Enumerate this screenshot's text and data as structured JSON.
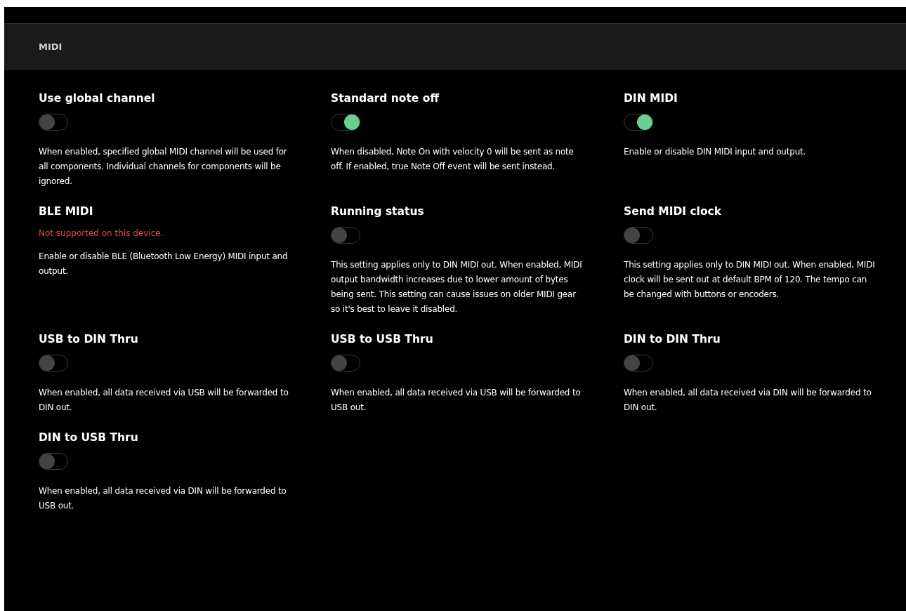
{
  "section": {
    "title": "MIDI"
  },
  "settings": [
    {
      "kind": "toggle",
      "title": "Use global channel",
      "on": false,
      "description": "When enabled, specified global MIDI channel will be used for all components. Individual channels for components will be ignored."
    },
    {
      "kind": "toggle",
      "title": "Standard note off",
      "on": true,
      "description": "When disabled, Note On with velocity 0 will be sent as note off. If enabled, true Note Off event will be sent instead."
    },
    {
      "kind": "toggle",
      "title": "DIN MIDI",
      "on": true,
      "description": "Enable or disable DIN MIDI input and output."
    },
    {
      "kind": "unsupported",
      "title": "BLE MIDI",
      "warning": "Not supported on this device.",
      "description": "Enable or disable BLE (Bluetooth Low Energy) MIDI input and output."
    },
    {
      "kind": "toggle",
      "title": "Running status",
      "on": false,
      "description": "This setting applies only to DIN MIDI out. When enabled, MIDI output bandwidth increases due to lower amount of bytes being sent. This setting can cause issues on older MIDI gear so it's best to leave it disabled."
    },
    {
      "kind": "toggle",
      "title": "Send MIDI clock",
      "on": false,
      "description": "This setting applies only to DIN MIDI out. When enabled, MIDI clock will be sent out at default BPM of 120. The tempo can be changed with buttons or encoders."
    },
    {
      "kind": "toggle",
      "title": "USB to DIN Thru",
      "on": false,
      "description": "When enabled, all data received via USB will be forwarded to DIN out."
    },
    {
      "kind": "toggle",
      "title": "USB to USB Thru",
      "on": false,
      "description": "When enabled, all data received via USB will be forwarded to USB out."
    },
    {
      "kind": "toggle",
      "title": "DIN to DIN Thru",
      "on": false,
      "description": "When enabled, all data received via DIN will be forwarded to DIN out."
    },
    {
      "kind": "toggle",
      "title": "DIN to USB Thru",
      "on": false,
      "description": "When enabled, all data received via DIN will be forwarded to USB out."
    }
  ]
}
